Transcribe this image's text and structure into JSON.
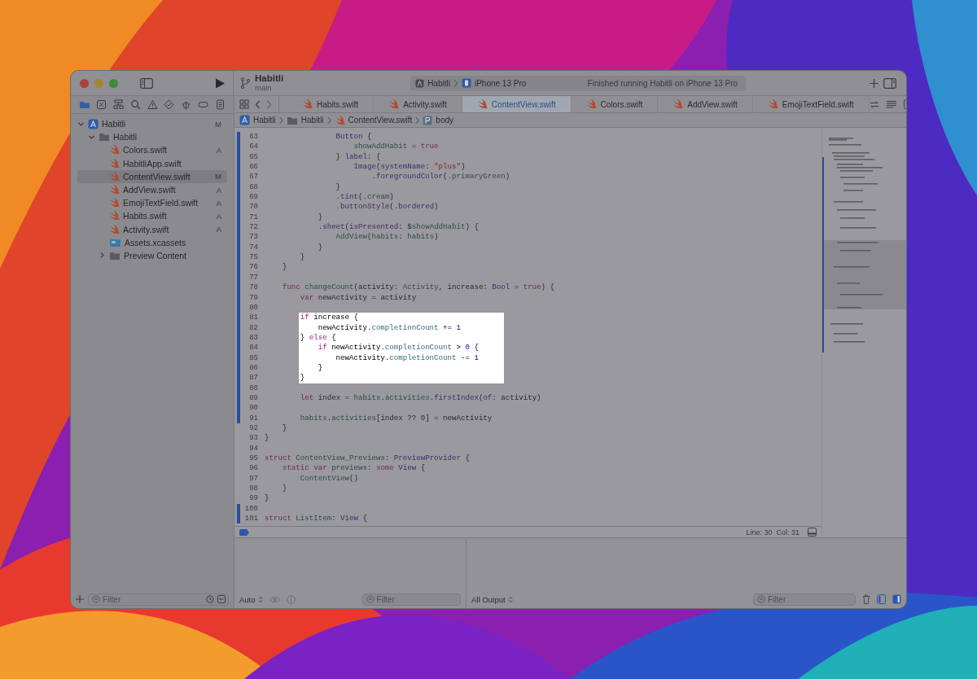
{
  "toolbar": {
    "project": "Habitli",
    "branch": "main",
    "scheme": "Habitli",
    "device": "iPhone 13 Pro",
    "status": "Finished running Habitli on iPhone 13 Pro"
  },
  "navigator": {
    "tree": [
      {
        "label": "Habitli",
        "kind": "project",
        "badge": "M",
        "expanded": true,
        "selected": false,
        "children": [
          {
            "label": "Habitli",
            "kind": "folder",
            "expanded": true,
            "selected": false,
            "children": [
              {
                "label": "Colors.swift",
                "kind": "swift",
                "badge": "A",
                "selected": false
              },
              {
                "label": "HabitliApp.swift",
                "kind": "swift",
                "selected": false
              },
              {
                "label": "ContentView.swift",
                "kind": "swift",
                "badge": "M",
                "selected": true
              },
              {
                "label": "AddView.swift",
                "kind": "swift",
                "badge": "A",
                "selected": false
              },
              {
                "label": "EmojiTextField.swift",
                "kind": "swift",
                "badge": "A",
                "selected": false
              },
              {
                "label": "Habits.swift",
                "kind": "swift",
                "badge": "A",
                "selected": false
              },
              {
                "label": "Activity.swift",
                "kind": "swift",
                "badge": "A",
                "selected": false
              },
              {
                "label": "Assets.xcassets",
                "kind": "assets",
                "selected": false
              },
              {
                "label": "Preview Content",
                "kind": "folder",
                "expanded": false,
                "selected": false
              }
            ]
          }
        ]
      }
    ],
    "filter_placeholder": "Filter"
  },
  "tabs": [
    {
      "label": "Habits.swift",
      "selected": false
    },
    {
      "label": "Activity.swift",
      "selected": false
    },
    {
      "label": "ContentView.swift",
      "selected": true
    },
    {
      "label": "Colors.swift",
      "selected": false
    },
    {
      "label": "AddView.swift",
      "selected": false
    },
    {
      "label": "EmojiTextField.swift",
      "selected": false
    }
  ],
  "breadcrumb": [
    {
      "label": "Habitli",
      "kind": "project"
    },
    {
      "label": "Habitli",
      "kind": "folder"
    },
    {
      "label": "ContentView.swift",
      "kind": "swift"
    },
    {
      "label": "body",
      "kind": "property"
    }
  ],
  "editor": {
    "lines": [
      {
        "number": "63",
        "changed": true,
        "spotlight": false,
        "tokens": [
          {
            "kind": "type",
            "text": "                Button"
          },
          {
            "kind": "plain",
            "text": " {"
          }
        ]
      },
      {
        "number": "64",
        "changed": true,
        "spotlight": false,
        "tokens": [
          {
            "kind": "prop",
            "text": "                    showAddHabit"
          },
          {
            "kind": "plain",
            "text": " = "
          },
          {
            "kind": "kw",
            "text": "true"
          }
        ]
      },
      {
        "number": "65",
        "changed": true,
        "spotlight": false,
        "tokens": [
          {
            "kind": "plain",
            "text": "                } "
          },
          {
            "kind": "type",
            "text": "label"
          },
          {
            "kind": "plain",
            "text": ": {"
          }
        ]
      },
      {
        "number": "66",
        "changed": true,
        "spotlight": false,
        "tokens": [
          {
            "kind": "type",
            "text": "                    Image"
          },
          {
            "kind": "plain",
            "text": "("
          },
          {
            "kind": "type",
            "text": "systemName"
          },
          {
            "kind": "plain",
            "text": ": "
          },
          {
            "kind": "str",
            "text": "\"plus\""
          },
          {
            "kind": "plain",
            "text": ")"
          }
        ]
      },
      {
        "number": "67",
        "changed": true,
        "spotlight": false,
        "tokens": [
          {
            "kind": "plain",
            "text": "                        ."
          },
          {
            "kind": "type",
            "text": "foregroundColor"
          },
          {
            "kind": "plain",
            "text": "(."
          },
          {
            "kind": "prop",
            "text": "primaryGreen"
          },
          {
            "kind": "plain",
            "text": ")"
          }
        ]
      },
      {
        "number": "68",
        "changed": true,
        "spotlight": false,
        "tokens": [
          {
            "kind": "plain",
            "text": "                }"
          }
        ]
      },
      {
        "number": "69",
        "changed": true,
        "spotlight": false,
        "tokens": [
          {
            "kind": "plain",
            "text": "                ."
          },
          {
            "kind": "type",
            "text": "tint"
          },
          {
            "kind": "plain",
            "text": "(."
          },
          {
            "kind": "prop",
            "text": "cream"
          },
          {
            "kind": "plain",
            "text": ")"
          }
        ]
      },
      {
        "number": "70",
        "changed": true,
        "spotlight": false,
        "tokens": [
          {
            "kind": "plain",
            "text": "                ."
          },
          {
            "kind": "type",
            "text": "buttonStyle"
          },
          {
            "kind": "plain",
            "text": "(."
          },
          {
            "kind": "type",
            "text": "bordered"
          },
          {
            "kind": "plain",
            "text": ")"
          }
        ]
      },
      {
        "number": "71",
        "changed": true,
        "spotlight": false,
        "tokens": [
          {
            "kind": "plain",
            "text": "            }"
          }
        ]
      },
      {
        "number": "72",
        "changed": true,
        "spotlight": false,
        "tokens": [
          {
            "kind": "plain",
            "text": "            ."
          },
          {
            "kind": "type",
            "text": "sheet"
          },
          {
            "kind": "plain",
            "text": "("
          },
          {
            "kind": "type",
            "text": "isPresented"
          },
          {
            "kind": "plain",
            "text": ": $"
          },
          {
            "kind": "prop",
            "text": "showAddHabit"
          },
          {
            "kind": "plain",
            "text": ") {"
          }
        ]
      },
      {
        "number": "73",
        "changed": true,
        "spotlight": false,
        "tokens": [
          {
            "kind": "prop",
            "text": "                AddView"
          },
          {
            "kind": "plain",
            "text": "("
          },
          {
            "kind": "prop",
            "text": "habits"
          },
          {
            "kind": "plain",
            "text": ": "
          },
          {
            "kind": "prop",
            "text": "habits"
          },
          {
            "kind": "plain",
            "text": ")"
          }
        ]
      },
      {
        "number": "74",
        "changed": true,
        "spotlight": false,
        "tokens": [
          {
            "kind": "plain",
            "text": "            }"
          }
        ]
      },
      {
        "number": "75",
        "changed": true,
        "spotlight": false,
        "tokens": [
          {
            "kind": "plain",
            "text": "        }"
          }
        ]
      },
      {
        "number": "76",
        "changed": true,
        "spotlight": false,
        "tokens": [
          {
            "kind": "plain",
            "text": "    }"
          }
        ]
      },
      {
        "number": "77",
        "changed": true,
        "spotlight": false
      },
      {
        "number": "78",
        "changed": true,
        "spotlight": false,
        "tokens": [
          {
            "kind": "kw",
            "text": "    func "
          },
          {
            "kind": "prop",
            "text": "changeCount"
          },
          {
            "kind": "plain",
            "text": "(activity: "
          },
          {
            "kind": "prop",
            "text": "Activity"
          },
          {
            "kind": "plain",
            "text": ", increase: "
          },
          {
            "kind": "type",
            "text": "Bool"
          },
          {
            "kind": "plain",
            "text": " = "
          },
          {
            "kind": "kw",
            "text": "true"
          },
          {
            "kind": "plain",
            "text": ") {"
          }
        ]
      },
      {
        "number": "79",
        "changed": true,
        "spotlight": false,
        "tokens": [
          {
            "kind": "kw",
            "text": "        var"
          },
          {
            "kind": "plain",
            "text": " newActivity = activity"
          }
        ]
      },
      {
        "number": "80",
        "changed": true,
        "spotlight": false
      },
      {
        "number": "81",
        "changed": true,
        "spotlight": true,
        "tokens": [
          {
            "kind": "kw",
            "text": "        if"
          },
          {
            "kind": "plain",
            "text": " increase {"
          }
        ]
      },
      {
        "number": "82",
        "changed": true,
        "spotlight": true,
        "tokens": [
          {
            "kind": "plain",
            "text": "            newActivity."
          },
          {
            "kind": "prop",
            "text": "completionCount"
          },
          {
            "kind": "plain",
            "text": " += "
          },
          {
            "kind": "num",
            "text": "1"
          }
        ]
      },
      {
        "number": "83",
        "changed": true,
        "spotlight": true,
        "tokens": [
          {
            "kind": "plain",
            "text": "        } "
          },
          {
            "kind": "kw",
            "text": "else"
          },
          {
            "kind": "plain",
            "text": " {"
          }
        ]
      },
      {
        "number": "84",
        "changed": true,
        "spotlight": true,
        "tokens": [
          {
            "kind": "kw",
            "text": "            if"
          },
          {
            "kind": "plain",
            "text": " newActivity."
          },
          {
            "kind": "prop",
            "text": "completionCount"
          },
          {
            "kind": "plain",
            "text": " > "
          },
          {
            "kind": "num",
            "text": "0"
          },
          {
            "kind": "plain",
            "text": " {"
          }
        ]
      },
      {
        "number": "85",
        "changed": true,
        "spotlight": true,
        "tokens": [
          {
            "kind": "plain",
            "text": "                newActivity."
          },
          {
            "kind": "prop",
            "text": "completionCount"
          },
          {
            "kind": "plain",
            "text": " -= "
          },
          {
            "kind": "num",
            "text": "1"
          }
        ]
      },
      {
        "number": "86",
        "changed": true,
        "spotlight": true,
        "tokens": [
          {
            "kind": "plain",
            "text": "            }"
          }
        ]
      },
      {
        "number": "87",
        "changed": true,
        "spotlight": true,
        "tokens": [
          {
            "kind": "plain",
            "text": "        }"
          }
        ]
      },
      {
        "number": "88",
        "changed": true,
        "spotlight": false
      },
      {
        "number": "89",
        "changed": true,
        "spotlight": false,
        "tokens": [
          {
            "kind": "kw",
            "text": "        let"
          },
          {
            "kind": "plain",
            "text": " index = "
          },
          {
            "kind": "prop",
            "text": "habits"
          },
          {
            "kind": "plain",
            "text": "."
          },
          {
            "kind": "prop",
            "text": "activities"
          },
          {
            "kind": "plain",
            "text": "."
          },
          {
            "kind": "type",
            "text": "firstIndex"
          },
          {
            "kind": "plain",
            "text": "("
          },
          {
            "kind": "type",
            "text": "of"
          },
          {
            "kind": "plain",
            "text": ": activity)"
          }
        ]
      },
      {
        "number": "90",
        "changed": true,
        "spotlight": false
      },
      {
        "number": "91",
        "changed": true,
        "spotlight": false,
        "tokens": [
          {
            "kind": "prop",
            "text": "        habits"
          },
          {
            "kind": "plain",
            "text": "."
          },
          {
            "kind": "prop",
            "text": "activities"
          },
          {
            "kind": "plain",
            "text": "[index ?? "
          },
          {
            "kind": "num",
            "text": "0"
          },
          {
            "kind": "plain",
            "text": "] = newActivity"
          }
        ]
      },
      {
        "number": "92",
        "changed": false,
        "spotlight": false,
        "tokens": [
          {
            "kind": "plain",
            "text": "    }"
          }
        ]
      },
      {
        "number": "93",
        "changed": false,
        "spotlight": false,
        "tokens": [
          {
            "kind": "plain",
            "text": "}"
          }
        ]
      },
      {
        "number": "94",
        "changed": false,
        "spotlight": false
      },
      {
        "number": "95",
        "changed": false,
        "spotlight": false,
        "tokens": [
          {
            "kind": "kw",
            "text": "struct "
          },
          {
            "kind": "prop",
            "text": "ContentView_Previews"
          },
          {
            "kind": "plain",
            "text": ": "
          },
          {
            "kind": "type",
            "text": "PreviewProvider"
          },
          {
            "kind": "plain",
            "text": " {"
          }
        ]
      },
      {
        "number": "96",
        "changed": false,
        "spotlight": false,
        "tokens": [
          {
            "kind": "kw",
            "text": "    static var "
          },
          {
            "kind": "prop",
            "text": "previews"
          },
          {
            "kind": "plain",
            "text": ": "
          },
          {
            "kind": "kw",
            "text": "some "
          },
          {
            "kind": "type",
            "text": "View"
          },
          {
            "kind": "plain",
            "text": " {"
          }
        ]
      },
      {
        "number": "97",
        "changed": false,
        "spotlight": false,
        "tokens": [
          {
            "kind": "prop",
            "text": "        ContentView"
          },
          {
            "kind": "plain",
            "text": "()"
          }
        ]
      },
      {
        "number": "98",
        "changed": false,
        "spotlight": false,
        "tokens": [
          {
            "kind": "plain",
            "text": "    }"
          }
        ]
      },
      {
        "number": "99",
        "changed": false,
        "spotlight": false,
        "tokens": [
          {
            "kind": "plain",
            "text": "}"
          }
        ]
      },
      {
        "number": "100",
        "changed": true,
        "spotlight": false
      },
      {
        "number": "101",
        "changed": true,
        "spotlight": false,
        "tokens": [
          {
            "kind": "kw",
            "text": "struct "
          },
          {
            "kind": "prop",
            "text": "ListItem"
          },
          {
            "kind": "plain",
            "text": ": "
          },
          {
            "kind": "type",
            "text": "View"
          },
          {
            "kind": "plain",
            "text": " {"
          }
        ]
      }
    ]
  },
  "status_bar": {
    "position": "Line: 30  Col: 31"
  },
  "debug": {
    "variables_mode": "Auto",
    "variables_filter_placeholder": "Filter",
    "output_mode": "All Output",
    "console_filter_placeholder": "Filter"
  }
}
